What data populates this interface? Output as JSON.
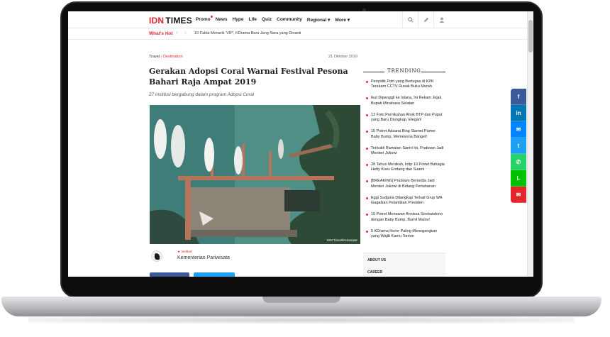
{
  "brand": {
    "idn": "IDN",
    "times": "TIMES"
  },
  "nav": {
    "items": [
      "Promo",
      "News",
      "Hype",
      "Life",
      "Quiz",
      "Community",
      "Regional",
      "More"
    ],
    "promo_indicator": "red-dot",
    "icons": [
      "search-icon",
      "edit-icon",
      "user-icon"
    ]
  },
  "hot": {
    "label": "What's Hot",
    "arrows": "‹ ›",
    "headline": "10 Fakta Menarik 'VIP', KDrama Baru Jang Nara yang Dinanti"
  },
  "article": {
    "category": "Travel",
    "separator": "›",
    "subcategory": "Destination",
    "date": "21 Oktober 2019",
    "title": "Gerakan Adopsi Coral Warnai Festival Pesona Bahari Raja Ampat 2019",
    "subtitle": "27 institusi bergabung dalam program Adopsi Coral",
    "photo_credit": "IDN Times/Kemenpar",
    "author_badge": "Verified",
    "author_name": "Kementerian Pariwisata"
  },
  "trending": {
    "heading": "TRENDING",
    "items": [
      "Penyidik Polri yang Bertugas di KPK Terekam CCTV Rusak Buku Merah",
      "Ikut Dipanggil ke Istana, Ini Rekam Jejak Bupati Minahasa Selatan",
      "13 Foto Pernikahan Ahok BTP dan Puput yang Baru Diungkap, Elegan!",
      "10 Potret Adzana Bing Slamet Pamer Baby Bump, Memesona Banget!",
      "Terbukti Ramalan Santri Ini, Prabowo Jadi Menteri Jokowi",
      "28 Tahun Menikah, Intip 10 Potret Bahagia Hetty Koes Endang dan Suami",
      "[BREAKING] Prabowo Bersedia Jadi Menteri Jokowi di Bidang Pertahanan",
      "Eggi Sudjana Ditangkap Terkait Grup WA Gagalkan Pelantikan Presiden",
      "10 Potret Menawan Annissa Soebandono dengan Baby Bump, Bumil Manis!",
      "5 KDrama Horor Paling Menegangkan yang Wajib Kamu Tonton"
    ]
  },
  "sidebar_links": [
    "ABOUT US",
    "CAREER"
  ],
  "share": [
    {
      "name": "facebook-icon",
      "glyph": "f",
      "color": "#3b5998"
    },
    {
      "name": "linkedin-icon",
      "glyph": "in",
      "color": "#0077b5"
    },
    {
      "name": "messenger-icon",
      "glyph": "✉",
      "color": "#0084ff"
    },
    {
      "name": "twitter-icon",
      "glyph": "t",
      "color": "#1da1f2"
    },
    {
      "name": "whatsapp-icon",
      "glyph": "✆",
      "color": "#25d366"
    },
    {
      "name": "line-icon",
      "glyph": "L",
      "color": "#00c300"
    },
    {
      "name": "email-icon",
      "glyph": "✉",
      "color": "#e3262b"
    }
  ],
  "colors": {
    "accent": "#e3262b"
  }
}
